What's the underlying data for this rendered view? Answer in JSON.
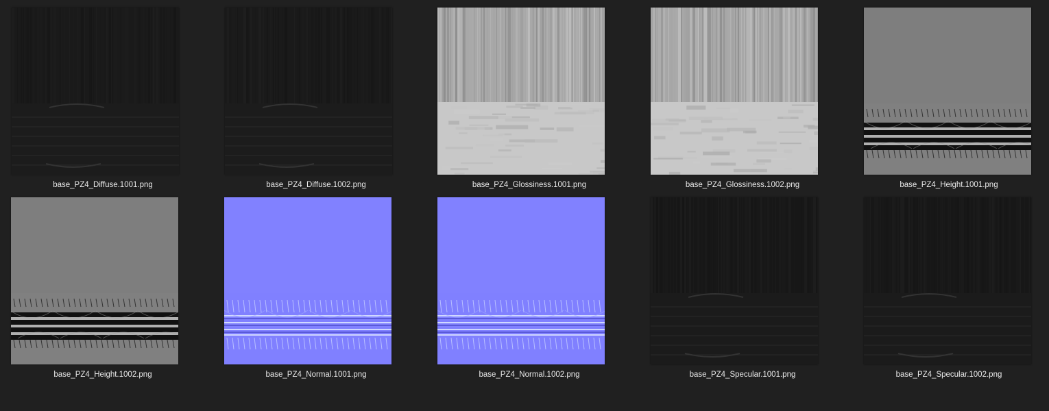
{
  "files": [
    {
      "name": "base_PZ4_Diffuse.1001.png",
      "type": "diffuse",
      "variant": "1001"
    },
    {
      "name": "base_PZ4_Diffuse.1002.png",
      "type": "diffuse",
      "variant": "1002"
    },
    {
      "name": "base_PZ4_Glossiness.1001.png",
      "type": "glossiness",
      "variant": "1001"
    },
    {
      "name": "base_PZ4_Glossiness.1002.png",
      "type": "glossiness",
      "variant": "1002"
    },
    {
      "name": "base_PZ4_Height.1001.png",
      "type": "height",
      "variant": "1001"
    },
    {
      "name": "base_PZ4_Height.1002.png",
      "type": "height",
      "variant": "1002"
    },
    {
      "name": "base_PZ4_Normal.1001.png",
      "type": "normal",
      "variant": "1001"
    },
    {
      "name": "base_PZ4_Normal.1002.png",
      "type": "normal",
      "variant": "1002"
    },
    {
      "name": "base_PZ4_Specular.1001.png",
      "type": "specular",
      "variant": "1001"
    },
    {
      "name": "base_PZ4_Specular.1002.png",
      "type": "specular",
      "variant": "1002"
    }
  ],
  "colors": {
    "background": "#202020",
    "label": "#e8e8e8",
    "diffuse_base": "#1a1a1a",
    "glossiness_top": "#a8a8a8",
    "glossiness_bottom": "#c8c8c8",
    "height_base": "#808080",
    "normal_base": "#8080ff",
    "specular_base": "#171717"
  }
}
